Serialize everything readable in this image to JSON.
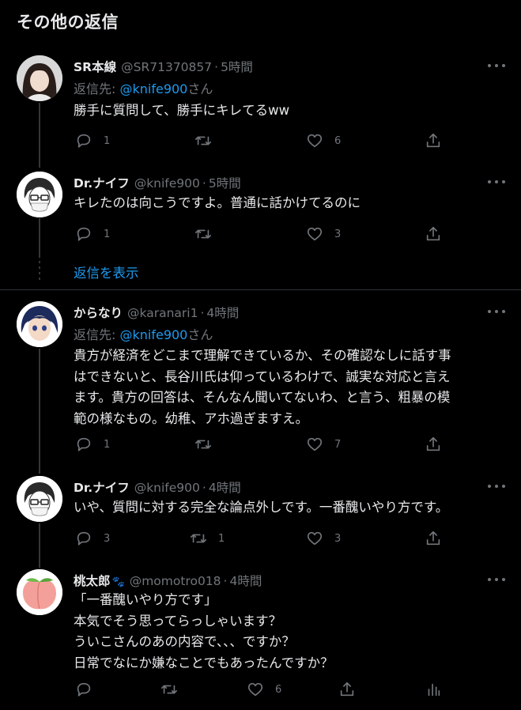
{
  "section": {
    "title": "その他の返信"
  },
  "tweets": [
    {
      "name": "SR本線",
      "handle": "@SR71370857",
      "sep": "·",
      "time": "5時間",
      "replyto_prefix": "返信先: ",
      "replyto_mention": "@knife900",
      "replyto_suffix": "さん",
      "text": "勝手に質問して、勝手にキレてるww",
      "replies": "1",
      "retweets": "",
      "likes": "6"
    },
    {
      "name": "Dr.ナイフ",
      "handle": "@knife900",
      "sep": "·",
      "time": "5時間",
      "text": "キレたのは向こうですよ。普通に話かけてるのに",
      "replies": "1",
      "retweets": "",
      "likes": "3"
    },
    {
      "name": "からなり",
      "handle": "@karanari1",
      "sep": "·",
      "time": "4時間",
      "replyto_prefix": "返信先: ",
      "replyto_mention": "@knife900",
      "replyto_suffix": "さん",
      "text": "貴方が経済をどこまで理解できているか、その確認なしに話す事\nはできないと、長谷川氏は仰っているわけで、誠実な対応と言え\nます。貴方の回答は、そんなん聞いてないわ、と言う、粗暴の模\n範の様なもの。幼稚、アホ過ぎますえ。",
      "replies": "1",
      "retweets": "",
      "likes": "7"
    },
    {
      "name": "Dr.ナイフ",
      "handle": "@knife900",
      "sep": "·",
      "time": "4時間",
      "text": "いや、質問に対する完全な論点外しです。一番醜いやり方です。",
      "replies": "3",
      "retweets": "1",
      "likes": "3"
    },
    {
      "name": "桃太郎",
      "handle": "@momotro018",
      "sep": "·",
      "time": "4時間",
      "text": "「一番醜いやり方です」\n本気でそう思ってらっしゃいます？\nういこさんのあの内容で、、、ですか？\n日常でなにか嫌なことでもあったんですか？",
      "replies": "",
      "retweets": "",
      "likes": "6"
    }
  ],
  "show_replies": "返信を表示",
  "icons": {
    "reply": "reply-icon",
    "retweet": "retweet-icon",
    "like": "heart-icon",
    "share": "share-icon",
    "analytics": "analytics-icon",
    "more": "more-icon"
  },
  "colors": {
    "background": "#000000",
    "text": "#e7e9ea",
    "muted": "#71767b",
    "link": "#1d9bf0",
    "divider": "#2f3336"
  }
}
